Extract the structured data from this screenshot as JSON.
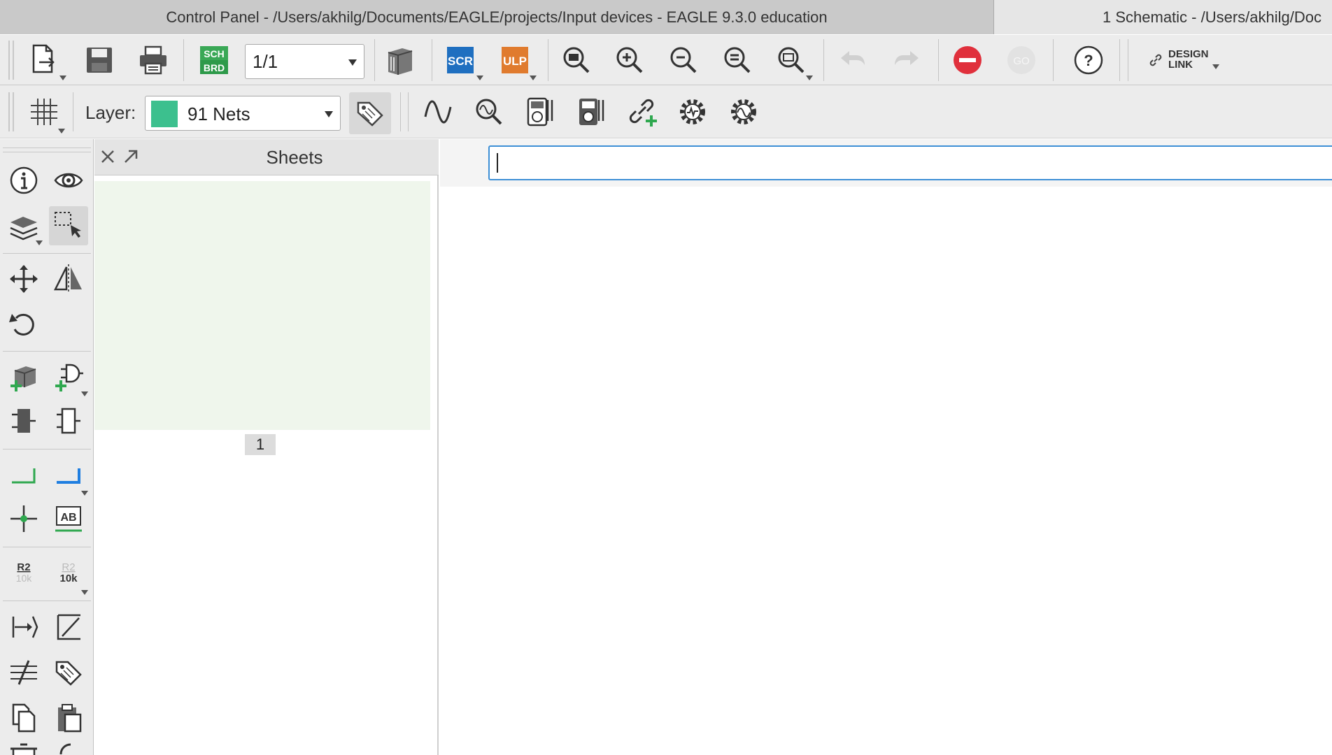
{
  "tabs": [
    {
      "label": "Control Panel - /Users/akhilg/Documents/EAGLE/projects/Input devices - EAGLE 9.3.0 education"
    },
    {
      "label": "1 Schematic - /Users/akhilg/Doc"
    }
  ],
  "toolbar": {
    "sch_brd_top": "SCH",
    "sch_brd_bottom": "BRD",
    "sheet_select": "1/1",
    "scr_label": "SCR",
    "ulp_label": "ULP",
    "go_label": "GO",
    "help_label": "?",
    "design_link_line1": "DESIGN",
    "design_link_line2": "LINK"
  },
  "layer": {
    "label": "Layer:",
    "value": "91 Nets",
    "swatch_color": "#3cc08e"
  },
  "sheets_panel": {
    "title": "Sheets",
    "sheet_numbers": [
      "1"
    ]
  },
  "left_toolbar": {
    "ab_label": "AB",
    "name_label": "R2",
    "name_value": "10k",
    "value_label": "R2",
    "value_value": "10k"
  },
  "command_line": {
    "value": ""
  },
  "colors": {
    "accent_blue": "#3d8fd6",
    "stop_red": "#e0303c",
    "scr_blue": "#1f6fc0",
    "ulp_orange": "#e07b2e",
    "green_add": "#2fa84f"
  }
}
